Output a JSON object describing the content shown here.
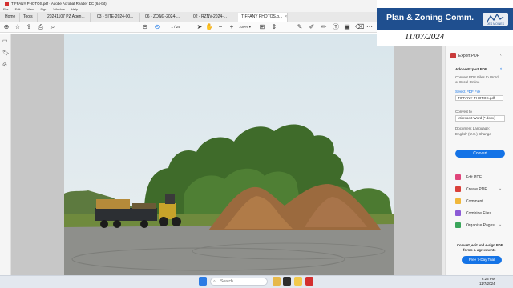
{
  "window": {
    "title": "TIFFANY PHOTOS.pdf - Adobe Acrobat Reader DC (64-bit)"
  },
  "menu": [
    "File",
    "Edit",
    "View",
    "Sign",
    "Window",
    "Help"
  ],
  "tabs": [
    {
      "label": "Home"
    },
    {
      "label": "Tools"
    },
    {
      "label": "20241107 PZ Agen..."
    },
    {
      "label": "03 - SITE-2024-00..."
    },
    {
      "label": "06 - ZONG-2024-..."
    },
    {
      "label": "02 - RZNV-2024-..."
    },
    {
      "label": "TIFFANY PHOTOS.p..."
    }
  ],
  "toolbar": {
    "page_current": "1",
    "page_total": "/ 24",
    "zoom": "100%"
  },
  "banner": {
    "title": "Plan & Zoning Comm.",
    "date": "11/07/2024",
    "logo_text": "DES MOINES"
  },
  "right_panel": {
    "export_header": "Export PDF",
    "export_title": "Adobe Export PDF",
    "export_desc_1": "Convert PDF Files to Word",
    "export_desc_2": "or Excel Online",
    "select_label": "Select PDF File",
    "selected_file": "TIFFANY PHOTOS.pdf",
    "convert_to_label": "Convert to",
    "convert_to_value": "Microsoft Word (*.docx)",
    "language_label": "Document Language:",
    "language_value": "English (U.S.)  Change",
    "convert_button": "Convert",
    "tools": [
      "Edit PDF",
      "Create PDF",
      "Comment",
      "Combine Files",
      "Organize Pages"
    ],
    "promo_1": "Convert, edit and e-sign PDF",
    "promo_2": "forms & agreements",
    "trial_button": "Free 7-Day Trial"
  },
  "taskbar": {
    "search_placeholder": "Search",
    "time": "6:23 PM",
    "date": "11/7/2024"
  },
  "colors": {
    "banner": "#1f4f8f",
    "accent": "#1473e6",
    "acrobat_red": "#d32f2f"
  }
}
